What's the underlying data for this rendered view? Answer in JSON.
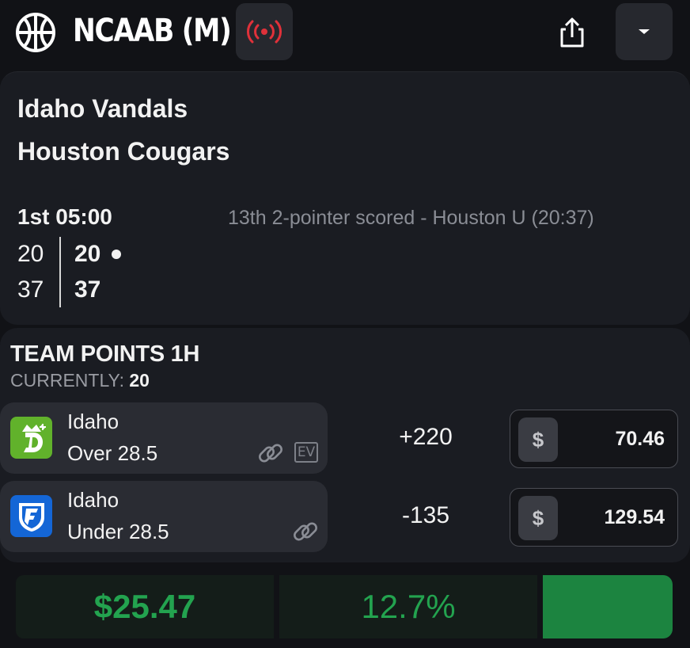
{
  "header": {
    "title": "NCAAB (M)",
    "icons": {
      "sport": "basketball-icon",
      "live": "broadcast-icon",
      "share": "share-icon",
      "menu": "caret-down-icon"
    },
    "live_color": "#e0313a"
  },
  "game": {
    "team_1": "Idaho Vandals",
    "team_2": "Houston Cougars",
    "clock": "1st 05:00",
    "last_play": "13th 2-pointer scored - Houston U (20:37)",
    "scores": {
      "row_1": [
        "20",
        "20"
      ],
      "row_2": [
        "37",
        "37"
      ]
    }
  },
  "market": {
    "title": "TEAM POINTS 1H",
    "current_label": "CURRENTLY:",
    "current_value": "20",
    "bets": [
      {
        "book_icon": "draftkings-logo-icon",
        "team": "Idaho",
        "line": "Over 28.5",
        "odds": "+220",
        "currency": "$",
        "stake": "70.46",
        "ev_badge": "EV"
      },
      {
        "book_icon": "fanduel-logo-icon",
        "team": "Idaho",
        "line": "Under 28.5",
        "odds": "-135",
        "currency": "$",
        "stake": "129.54"
      }
    ]
  },
  "summary": {
    "profit": "$25.47",
    "roi": "12.7%",
    "accent": "#23a34f"
  }
}
